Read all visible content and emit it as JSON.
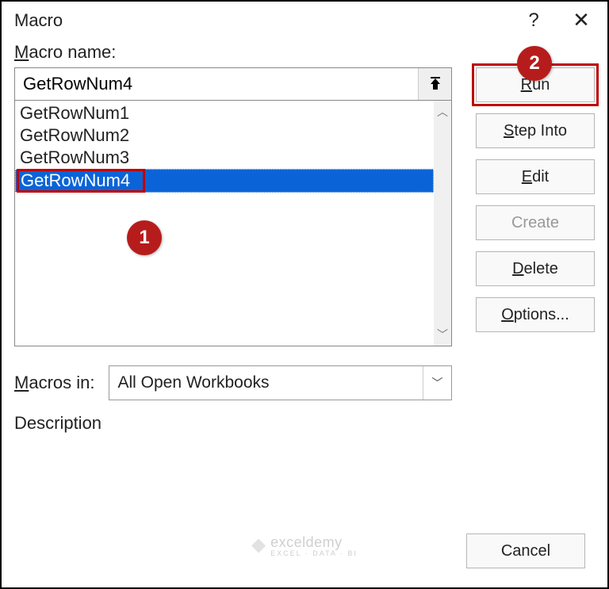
{
  "dialog": {
    "title": "Macro",
    "help_symbol": "?",
    "close_symbol": "✕"
  },
  "labels": {
    "macro_name_prefix": "M",
    "macro_name_rest": "acro name:",
    "macros_in_prefix": "M",
    "macros_in_rest": "acros in:",
    "description": "Description"
  },
  "macro_name_input": "GetRowNum4",
  "macro_list": [
    "GetRowNum1",
    "GetRowNum2",
    "GetRowNum3",
    "GetRowNum4"
  ],
  "selected_index": 3,
  "macros_in_value": "All Open Workbooks",
  "buttons": {
    "run_u": "R",
    "run_rest": "un",
    "step_prefix": "S",
    "step_rest": "tep Into",
    "edit_prefix": "E",
    "edit_rest": "dit",
    "create": "Create",
    "delete_prefix": "D",
    "delete_rest": "elete",
    "options_prefix": "O",
    "options_rest": "ptions...",
    "cancel": "Cancel"
  },
  "callouts": {
    "one": "1",
    "two": "2"
  },
  "watermark": {
    "main": "exceldemy",
    "sub": "EXCEL · DATA · BI"
  }
}
